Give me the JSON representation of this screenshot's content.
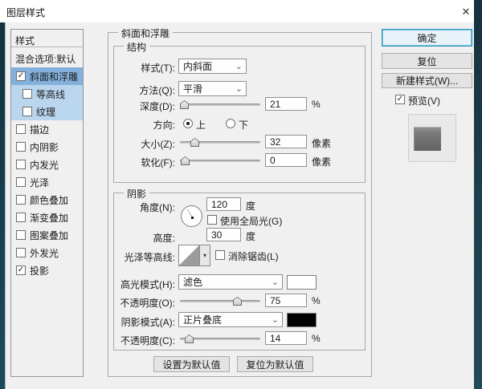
{
  "window": {
    "title": "图层样式"
  },
  "icons": {
    "close": "✕",
    "check": "✓",
    "chevron": "⌄",
    "dropdown_arrow": "▾"
  },
  "sidebar": {
    "header": "样式",
    "items": [
      {
        "label": "混合选项:默认",
        "checkbox": false,
        "checked": false
      },
      {
        "label": "斜面和浮雕",
        "checkbox": true,
        "checked": true,
        "selected": true
      },
      {
        "label": "等高线",
        "checkbox": true,
        "checked": false,
        "indented": true,
        "highlighted": true
      },
      {
        "label": "纹理",
        "checkbox": true,
        "checked": false,
        "indented": true,
        "highlighted": true
      },
      {
        "label": "描边",
        "checkbox": true,
        "checked": false
      },
      {
        "label": "内阴影",
        "checkbox": true,
        "checked": false
      },
      {
        "label": "内发光",
        "checkbox": true,
        "checked": false
      },
      {
        "label": "光泽",
        "checkbox": true,
        "checked": false
      },
      {
        "label": "颜色叠加",
        "checkbox": true,
        "checked": false
      },
      {
        "label": "渐变叠加",
        "checkbox": true,
        "checked": false
      },
      {
        "label": "图案叠加",
        "checkbox": true,
        "checked": false
      },
      {
        "label": "外发光",
        "checkbox": true,
        "checked": false
      },
      {
        "label": "投影",
        "checkbox": true,
        "checked": true
      }
    ]
  },
  "panel": {
    "title": "斜面和浮雕",
    "structure": {
      "legend": "结构",
      "style_label": "样式(T):",
      "style_value": "内斜面",
      "technique_label": "方法(Q):",
      "technique_value": "平滑",
      "depth_label": "深度(D):",
      "depth_value": "21",
      "depth_unit": "%",
      "direction_label": "方向:",
      "direction_up": "上",
      "direction_down": "下",
      "direction_selected": "上",
      "size_label": "大小(Z):",
      "size_value": "32",
      "size_unit": "像素",
      "soften_label": "软化(F):",
      "soften_value": "0",
      "soften_unit": "像素"
    },
    "shading": {
      "legend": "阴影",
      "angle_label": "角度(N):",
      "angle_value": "120",
      "angle_unit": "度",
      "global_light_label": "使用全局光(G)",
      "global_light_checked": false,
      "altitude_label": "高度:",
      "altitude_value": "30",
      "altitude_unit": "度",
      "gloss_contour_label": "光泽等高线:",
      "anti_alias_label": "消除锯齿(L)",
      "anti_alias_checked": false,
      "highlight_mode_label": "高光模式(H):",
      "highlight_mode_value": "滤色",
      "highlight_color": "#ffffff",
      "highlight_opacity_label": "不透明度(O):",
      "highlight_opacity_value": "75",
      "highlight_opacity_unit": "%",
      "shadow_mode_label": "阴影模式(A):",
      "shadow_mode_value": "正片叠底",
      "shadow_color": "#000000",
      "shadow_opacity_label": "不透明度(C):",
      "shadow_opacity_value": "14",
      "shadow_opacity_unit": "%"
    },
    "footer": {
      "set_default": "设置为默认值",
      "reset_default": "复位为默认值"
    }
  },
  "actions": {
    "ok": "确定",
    "reset": "复位",
    "new_style": "新建样式(W)...",
    "preview": "预览(V)",
    "preview_checked": true
  },
  "colors": {
    "selected_row": "#84b1dc",
    "child_row": "#bad5ee",
    "ok_focus_border": "#2e93b9",
    "highlight_swatch": "#ffffff",
    "shadow_swatch": "#000000"
  }
}
